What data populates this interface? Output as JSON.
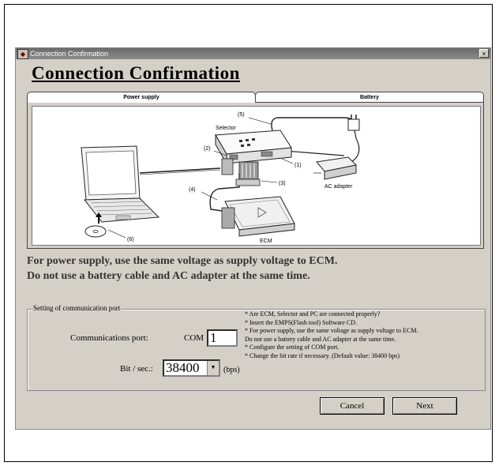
{
  "window": {
    "title": "Connection Confirmation",
    "close_glyph": "×"
  },
  "heading": "Connection Confirmation",
  "tabs": [
    {
      "label": "Power supply",
      "active": true
    },
    {
      "label": "Battery",
      "active": false
    }
  ],
  "diagram": {
    "labels": {
      "selector": "Selector",
      "ac_adapter": "AC adapter",
      "ecm": "ECM",
      "c1": "(1)",
      "c2": "(2)",
      "c3": "(3)",
      "c4": "(4)",
      "c5": "(5)",
      "c6": "(6)"
    }
  },
  "info": {
    "line1": "For power supply, use the same voltage as supply voltage to ECM.",
    "line2": "Do not use a battery cable and AC adapter at the same time."
  },
  "comm": {
    "group_title": "Setting of communication port",
    "port_label": "Communications port:",
    "port_prefix": "COM",
    "port_value": "1",
    "rate_label": "Bit / sec.:",
    "rate_value": "38400",
    "rate_unit": "(bps)"
  },
  "notes": [
    "* Are ECM, Selector and PC are connected properly?",
    "* Insert the EMPS(Flash tool) Software CD.",
    "* For power supply, use the same voltage as supply voltage to ECM.",
    "Do not use a battery cable and AC adapter at the same time.",
    "* Configure the setting of COM port.",
    "* Change the bit rate if necessary. (Default value: 38400 bps)"
  ],
  "buttons": {
    "cancel": "Cancel",
    "next": "Next"
  }
}
